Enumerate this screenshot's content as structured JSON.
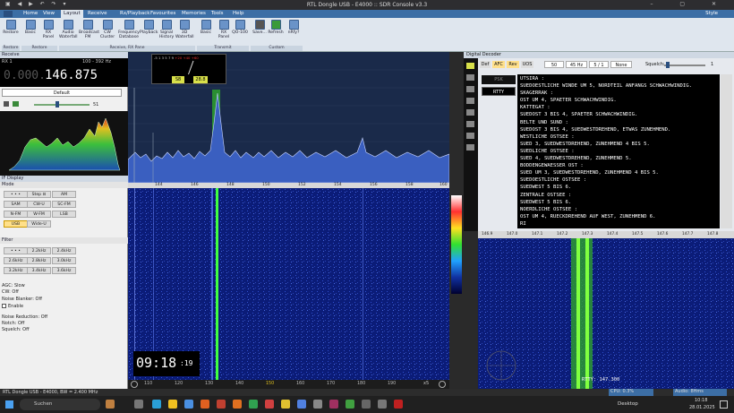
{
  "window": {
    "title": "RTL Dongle USB - E4000 :: SDR Console v3.3"
  },
  "menu": {
    "items": [
      "Home",
      "View",
      "Layout",
      "Receive",
      "Rx/Playback",
      "Favourites",
      "Memories",
      "Tools",
      "Help"
    ],
    "active": "Layout",
    "style_label": "Style"
  },
  "ribbon": {
    "buttons": [
      "Restore",
      "Basic",
      "RX Panel",
      "Audio Waterfall",
      "Broadcast FM",
      "CW Cluster",
      "Frequency Database",
      "Playback",
      "Signal History",
      "3D Waterfall",
      "Basic",
      "RX Panel",
      "QO-100",
      "Save...",
      "Refresh",
      "nRfy?"
    ],
    "groups": [
      "Restore",
      "Restore",
      "Receive, RX Pane",
      "Transmit",
      "Custom"
    ]
  },
  "receive": {
    "header": "Receive",
    "rx_label": "RX 1",
    "range": "100 - 392 Hz",
    "frequency_dim": "0.000.",
    "frequency": "146.875",
    "profile": "Default",
    "volume": "51",
    "if_display": "IF Display",
    "mode_header": "Mode",
    "modes": [
      "• • •",
      "Step ⊡",
      "AM",
      "SAM",
      "CW-U",
      "SC-FM",
      "N-FM",
      "W-FM",
      "LSB",
      "USB",
      "Wide-U"
    ],
    "filter_header": "Filter",
    "filters": [
      "• • •",
      "2.2kHz",
      "2.4kHz",
      "2.6kHz",
      "2.8kHz",
      "3.0kHz",
      "3.2kHz",
      "3.4kHz",
      "3.6kHz"
    ],
    "agc": "AGC: Slow",
    "cw": "CW: Off",
    "noise_blanker": "Noise Blanker: Off",
    "enable": "Enable",
    "noise_reduction": "Noise Reduction: Off",
    "notch": "Notch: Off",
    "squelch": "Squelch: Off"
  },
  "spectrum": {
    "smeter_values": [
      "S8",
      "28.8"
    ],
    "smeter_scale": [
      "-5",
      "1",
      "3",
      "5",
      "7",
      "9",
      "+20",
      "+40",
      "+60"
    ],
    "freq_ticks": [
      "144",
      "146",
      "148",
      "150",
      "152",
      "154",
      "156",
      "158",
      "160"
    ],
    "level_ticks": [
      "+15",
      "+10",
      "+5",
      "S9",
      "S8",
      "S7",
      "S6",
      "S5",
      "S4",
      "S3",
      "S2",
      "S1"
    ]
  },
  "waterfall": {
    "time_hm": "09:18",
    "time_s": ":19",
    "bottom_ticks": [
      "110",
      "120",
      "130",
      "140",
      "150",
      "160",
      "170",
      "180",
      "190"
    ],
    "zoom": "x5"
  },
  "decoder": {
    "header": "Digital Decoder",
    "tabs": [
      "Def",
      "AFC",
      "Rev",
      "UOS"
    ],
    "dropdowns": [
      "50",
      "45 Hz",
      "5 / 1",
      "None"
    ],
    "squelch_label": "Squelch:",
    "squelch_value": "1",
    "modes": [
      "PSK",
      "RTTY"
    ],
    "lines": [
      "UTSIRA :",
      "SUEDOESTLICHE WINDE UM 5, NORDTEIL ANFANGS SCHWACHWINDIG.",
      "SKAGERRAK :",
      "OST UM 4, SPAETER SCHWACHWINDIG.",
      "KATTEGAT :",
      "SUEDOST 3 BIS 4, SPAETER SCHWACHWINDIG.",
      "BELTE UND SUND :",
      "SUEDOST 3 BIS 4, SUEDWESTDREHEND, ETWAS ZUNEHMEND.",
      "WESTLICHE OSTSEE :",
      "SUED 3, SUEDWESTDREHEND, ZUNEHMEND 4 BIS 5.",
      "SUEDLICHE OSTSEE :",
      "SUED 4, SUEDWESTDREHEND, ZUNEHMEND 5.",
      "BODDENGEWAESSER OST :",
      "SUED UM 3, SUEDWESTDREHEND, ZUNEHMEND 4 BIS 5.",
      "SUEDOESTLICHE OSTSEE :",
      "SUEDWEST 5 BIS 6.",
      "ZENTRALE OSTSEE :",
      "SUEDWEST 5 BIS 6.",
      "NOERDLICHE OSTSEE :",
      "OST UM 4, RUECKDREHEND AUF WEST, ZUNEHMEND 6.",
      "RI"
    ],
    "wf_ticks": [
      "146.9",
      "147.0",
      "147.1",
      "147.2",
      "147.3",
      "147.4",
      "147.5",
      "147.6",
      "147.7",
      "147.8"
    ],
    "rtty_label": "RTTY: 147.300"
  },
  "status": {
    "left": "RTL Dongle USB - E4000, BW = 2.400 MHz",
    "cpu": "CPU: 0.3%",
    "audio": "Audio: 8Hms"
  },
  "taskbar": {
    "search": "Suchen",
    "desktop": "Desktop",
    "time": "10:18",
    "date": "28.01.2025"
  },
  "colors": {
    "accent": "#3c6ea5",
    "signal": "#33ff33",
    "freq": "#ffffff"
  }
}
